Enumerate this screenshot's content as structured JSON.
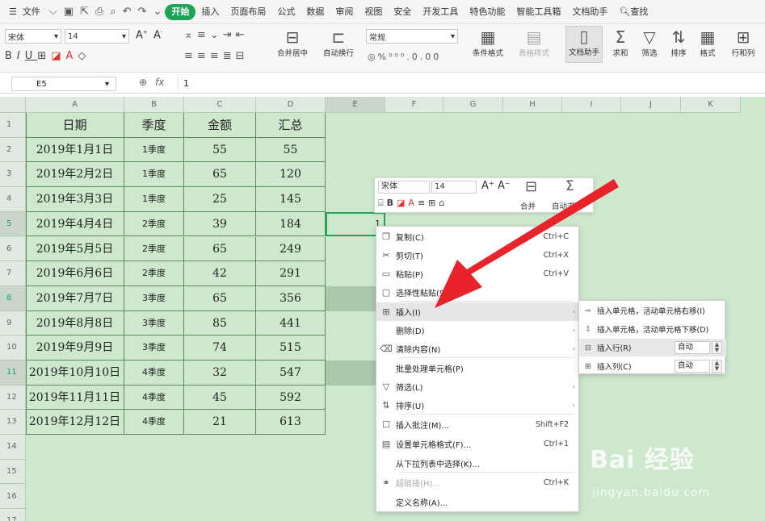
{
  "menubar": {
    "file": "文件",
    "tabs": [
      "开始",
      "插入",
      "页面布局",
      "公式",
      "数据",
      "审阅",
      "视图",
      "安全",
      "开发工具",
      "特色功能",
      "智能工具箱",
      "文档助手"
    ],
    "search": "查找"
  },
  "ribbon": {
    "font_name": "宋体",
    "font_size": "14",
    "merge": "合并居中",
    "wrap": "自动换行",
    "number_format": "常规",
    "cond_format": "条件格式",
    "table_style": "表格样式",
    "doc_helper": "文档助手",
    "sum": "求和",
    "filter": "筛选",
    "sort": "排序",
    "format": "格式",
    "rowcol": "行和列"
  },
  "formula_bar": {
    "cell_ref": "E5",
    "fx": "fx",
    "value": "1"
  },
  "columns": [
    "A",
    "B",
    "C",
    "D",
    "E",
    "F",
    "G",
    "H",
    "I",
    "J",
    "K"
  ],
  "rows": [
    "1",
    "2",
    "3",
    "4",
    "5",
    "6",
    "7",
    "8",
    "9",
    "10",
    "11",
    "12",
    "13",
    "14",
    "15",
    "16",
    "17"
  ],
  "table": {
    "headers": [
      "日期",
      "季度",
      "金额",
      "汇总"
    ],
    "data": [
      [
        "2019年1月1日",
        "1季度",
        "55",
        "55"
      ],
      [
        "2019年2月2日",
        "1季度",
        "65",
        "120"
      ],
      [
        "2019年3月3日",
        "1季度",
        "25",
        "145"
      ],
      [
        "2019年4月4日",
        "2季度",
        "39",
        "184"
      ],
      [
        "2019年5月5日",
        "2季度",
        "65",
        "249"
      ],
      [
        "2019年6月6日",
        "2季度",
        "42",
        "291"
      ],
      [
        "2019年7月7日",
        "3季度",
        "65",
        "356"
      ],
      [
        "2019年8月8日",
        "3季度",
        "85",
        "441"
      ],
      [
        "2019年9月9日",
        "3季度",
        "74",
        "515"
      ],
      [
        "2019年10月10日",
        "4季度",
        "32",
        "547"
      ],
      [
        "2019年11月11日",
        "4季度",
        "45",
        "592"
      ],
      [
        "2019年12月12日",
        "4季度",
        "21",
        "613"
      ]
    ],
    "e5_value": "1"
  },
  "mini_toolbar": {
    "font": "宋体",
    "size": "14",
    "merge": "合并",
    "autosum": "自动求和"
  },
  "context_menu": [
    {
      "icon": "copy-icon",
      "label": "复制(C)",
      "shortcut": "Ctrl+C"
    },
    {
      "icon": "cut-icon",
      "label": "剪切(T)",
      "shortcut": "Ctrl+X"
    },
    {
      "icon": "paste-icon",
      "label": "粘贴(P)",
      "shortcut": "Ctrl+V"
    },
    {
      "icon": "paste-special-icon",
      "label": "选择性粘贴(S)...",
      "shortcut": ""
    },
    {
      "icon": "insert-icon",
      "label": "插入(I)",
      "shortcut": ""
    },
    {
      "icon": "",
      "label": "删除(D)",
      "shortcut": ""
    },
    {
      "icon": "clear-icon",
      "label": "清除内容(N)",
      "shortcut": ""
    },
    {
      "icon": "",
      "label": "批量处理单元格(P)",
      "shortcut": ""
    },
    {
      "icon": "filter-icon",
      "label": "筛选(L)",
      "shortcut": ""
    },
    {
      "icon": "sort-icon",
      "label": "排序(U)",
      "shortcut": ""
    },
    {
      "icon": "comment-icon",
      "label": "插入批注(M)...",
      "shortcut": "Shift+F2"
    },
    {
      "icon": "format-cells-icon",
      "label": "设置单元格格式(F)...",
      "shortcut": "Ctrl+1"
    },
    {
      "icon": "",
      "label": "从下拉列表中选择(K)...",
      "shortcut": ""
    },
    {
      "icon": "link-icon",
      "label": "超链接(H)...",
      "shortcut": "Ctrl+K"
    },
    {
      "icon": "",
      "label": "定义名称(A)...",
      "shortcut": ""
    }
  ],
  "submenu": {
    "shift_right": "插入单元格，活动单元格右移(I)",
    "shift_down": "插入单元格，活动单元格下移(D)",
    "insert_row": "插入行(R)",
    "insert_col": "插入列(C)",
    "row_count": "自动",
    "col_count": "自动"
  },
  "watermark": {
    "brand": "Bai 经验",
    "url": "jingyan.baidu.com"
  },
  "colors": {
    "accent_green": "#1ea456",
    "grid_bg": "#cde8cd",
    "arrow_red": "#e8232a"
  }
}
